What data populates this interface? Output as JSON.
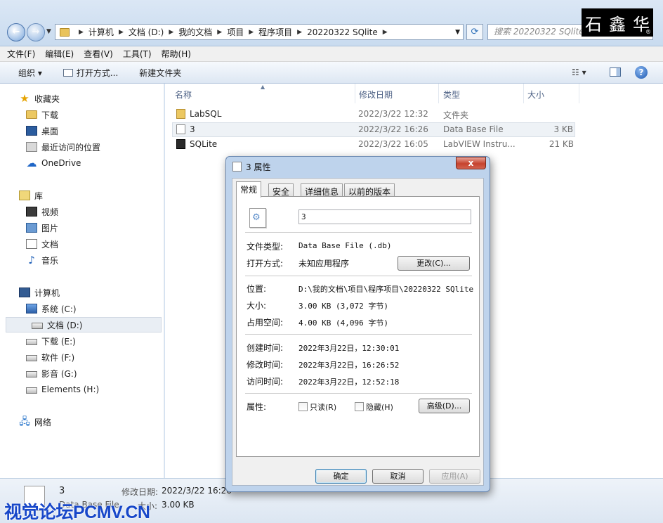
{
  "address": {
    "crumbs": [
      "计算机",
      "文档 (D:)",
      "我的文档",
      "项目",
      "程序项目",
      "20220322 SQlite"
    ],
    "search_placeholder": "搜索 20220322 SQlite"
  },
  "watermark": {
    "chars": [
      "石",
      "鑫",
      "华"
    ],
    "reg": "®"
  },
  "menu": [
    "文件(F)",
    "编辑(E)",
    "查看(V)",
    "工具(T)",
    "帮助(H)"
  ],
  "toolbar": {
    "organize": "组织 ▾",
    "open_with": "打开方式...",
    "new_folder": "新建文件夹",
    "view": "▾"
  },
  "nav": {
    "favorites": "收藏夹",
    "downloads": "下载",
    "desktop": "桌面",
    "recent": "最近访问的位置",
    "onedrive": "OneDrive",
    "library": "库",
    "videos": "视频",
    "pictures": "图片",
    "documents": "文档",
    "music": "音乐",
    "computer": "计算机",
    "drive_c": "系统 (C:)",
    "drive_d": "文档 (D:)",
    "drive_e": "下载 (E:)",
    "drive_f": "软件 (F:)",
    "drive_g": "影音 (G:)",
    "drive_h": "Elements (H:)",
    "network": "网络"
  },
  "columns": {
    "name": "名称",
    "date": "修改日期",
    "type": "类型",
    "size": "大小"
  },
  "files": [
    {
      "name": "LabSQL",
      "date": "2022/3/22 12:32",
      "type": "文件夹",
      "size": ""
    },
    {
      "name": "3",
      "date": "2022/3/22 16:26",
      "type": "Data Base File",
      "size": "3 KB"
    },
    {
      "name": "SQLite",
      "date": "2022/3/22 16:05",
      "type": "LabVIEW Instru...",
      "size": "21 KB"
    }
  ],
  "details": {
    "name": "3",
    "type": "Data Base File",
    "modified_label": "修改日期:",
    "modified_value": "2022/3/22 16:26",
    "size_label": "大小:",
    "size_value": "3.00 KB"
  },
  "site_watermark": "视觉论坛PCMV.CN",
  "dialog": {
    "title": "3 属性",
    "close": "x",
    "tabs": [
      "常规",
      "安全",
      "详细信息",
      "以前的版本"
    ],
    "filename": "3",
    "file_type_label": "文件类型:",
    "file_type_value": "Data Base File (.db)",
    "open_with_label": "打开方式:",
    "open_with_value": "未知应用程序",
    "change_btn": "更改(C)...",
    "location_label": "位置:",
    "location_value": "D:\\我的文档\\项目\\程序项目\\20220322 SQlite",
    "size_label": "大小:",
    "size_value": "3.00 KB (3,072 字节)",
    "disk_label": "占用空间:",
    "disk_value": "4.00 KB (4,096 字节)",
    "created_label": "创建时间:",
    "created_value": "2022年3月22日，12:30:01",
    "modified_label": "修改时间:",
    "modified_value": "2022年3月22日，16:26:52",
    "accessed_label": "访问时间:",
    "accessed_value": "2022年3月22日，12:52:18",
    "attr_label": "属性:",
    "readonly": "只读(R)",
    "hidden": "隐藏(H)",
    "advanced_btn": "高级(D)...",
    "ok": "确定",
    "cancel": "取消",
    "apply": "应用(A)"
  }
}
